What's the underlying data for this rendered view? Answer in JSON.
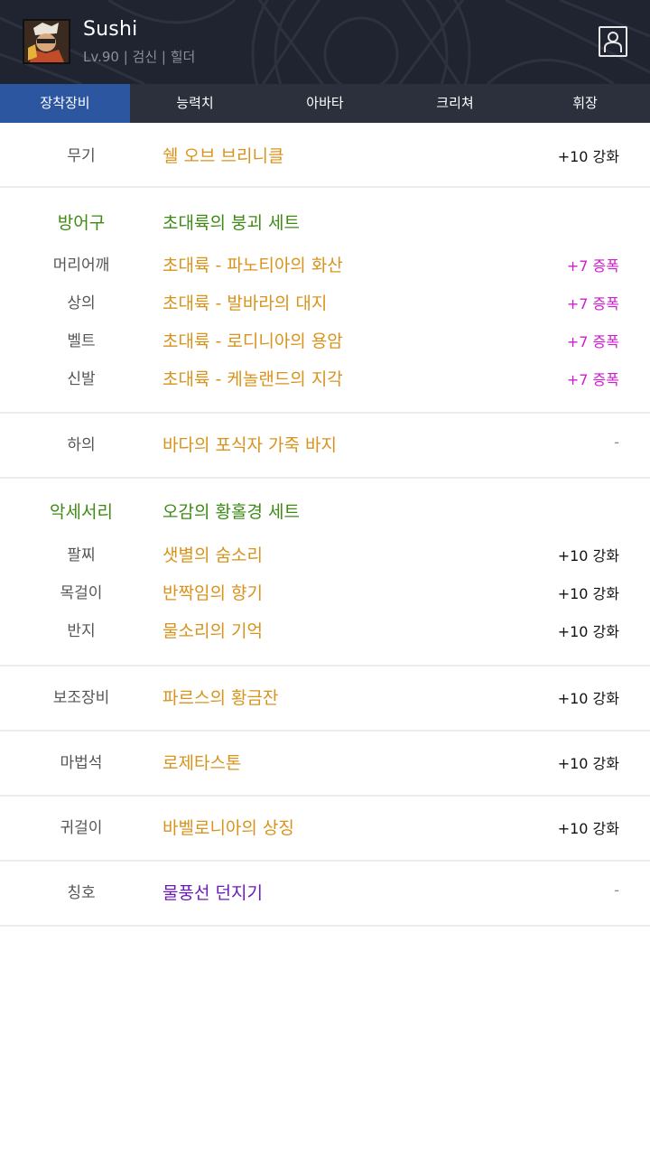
{
  "character": {
    "name": "Sushi",
    "info": "Lv.90 | 검신 | 힐더"
  },
  "tabs": [
    "장착장비",
    "능력치",
    "아바타",
    "크리쳐",
    "휘장"
  ],
  "active_tab": "장착장비",
  "colors": {
    "tab_active": "#2d56a0",
    "item_orange": "#d8931c",
    "set_green": "#3d8a14",
    "amplify_magenta": "#d21bd0",
    "title_purple": "#6a1bb8"
  },
  "equipment": {
    "weapon": {
      "category": "무기",
      "name": "쉘 오브 브리니클",
      "value": "+10 강화"
    },
    "armor": {
      "category": "방어구",
      "set_name": "초대륙의 붕괴 세트",
      "items": [
        {
          "slot": "머리어깨",
          "name": "초대륙 - 파노티아의 화산",
          "value": "+7 증폭"
        },
        {
          "slot": "상의",
          "name": "초대륙 - 발바라의 대지",
          "value": "+7 증폭"
        },
        {
          "slot": "벨트",
          "name": "초대륙 - 로디니아의 용암",
          "value": "+7 증폭"
        },
        {
          "slot": "신발",
          "name": "초대륙 - 케놀랜드의 지각",
          "value": "+7 증폭"
        }
      ]
    },
    "pants": {
      "category": "하의",
      "name": "바다의 포식자 가죽 바지",
      "value": "-"
    },
    "accessory": {
      "category": "악세서리",
      "set_name": "오감의 황홀경 세트",
      "items": [
        {
          "slot": "팔찌",
          "name": "샛별의 숨소리",
          "value": "+10 강화"
        },
        {
          "slot": "목걸이",
          "name": "반짝임의 향기",
          "value": "+10 강화"
        },
        {
          "slot": "반지",
          "name": "물소리의 기억",
          "value": "+10 강화"
        }
      ]
    },
    "sub": {
      "category": "보조장비",
      "name": "파르스의 황금잔",
      "value": "+10 강화"
    },
    "magicstone": {
      "category": "마법석",
      "name": "로제타스톤",
      "value": "+10 강화"
    },
    "earring": {
      "category": "귀걸이",
      "name": "바벨로니아의 상징",
      "value": "+10 강화"
    },
    "title": {
      "category": "칭호",
      "name": "물풍선 던지기",
      "value": "-"
    }
  }
}
